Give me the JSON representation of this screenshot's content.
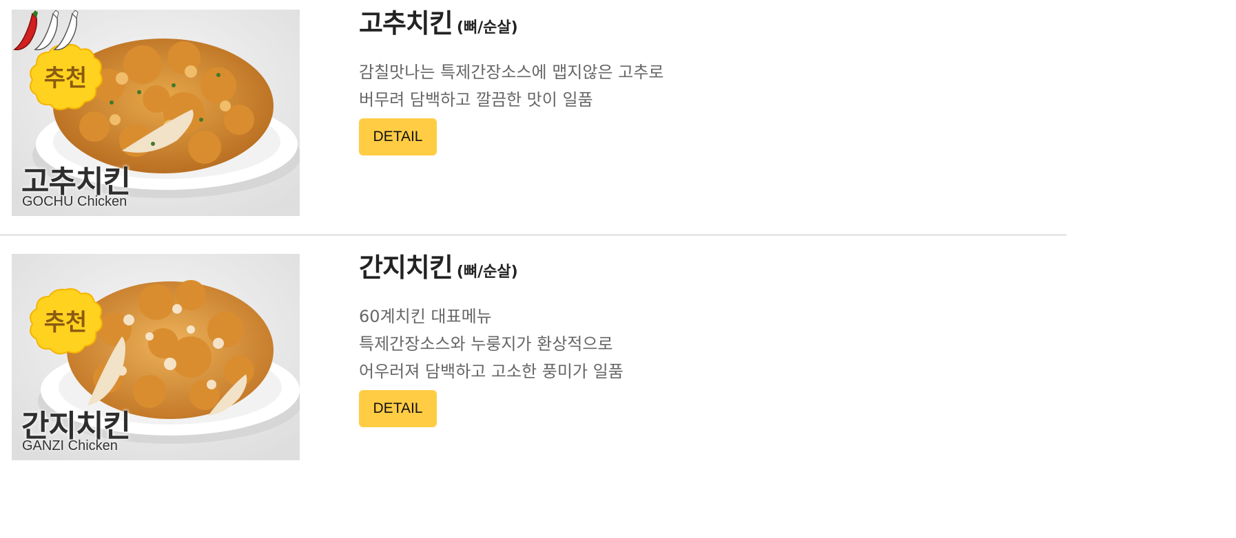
{
  "menu_items": [
    {
      "title": "고추치킨",
      "subtitle": "(뼈/순살)",
      "description_lines": [
        "감칠맛나는 특제간장소스에 맵지않은 고추로",
        "버무려 담백하고 깔끔한 맛이 일품"
      ],
      "detail_label": "DETAIL",
      "image": {
        "name_ko": "고추치킨",
        "name_en": "GOCHU Chicken",
        "badge": "추천",
        "spice_level": 1,
        "spice_max": 3
      }
    },
    {
      "title": "간지치킨",
      "subtitle": "(뼈/순살)",
      "description_lines": [
        "60계치킨 대표메뉴",
        "특제간장소스와 누룽지가 환상적으로",
        "어우러져 담백하고 고소한 풍미가 일품"
      ],
      "detail_label": "DETAIL",
      "image": {
        "name_ko": "간지치킨",
        "name_en": "GANZI Chicken",
        "badge": "추천"
      }
    }
  ],
  "colors": {
    "button_bg": "#ffcc44",
    "badge_yellow": "#ffd21f",
    "pepper_red": "#d21f1f",
    "divider": "#e6e6e6"
  }
}
